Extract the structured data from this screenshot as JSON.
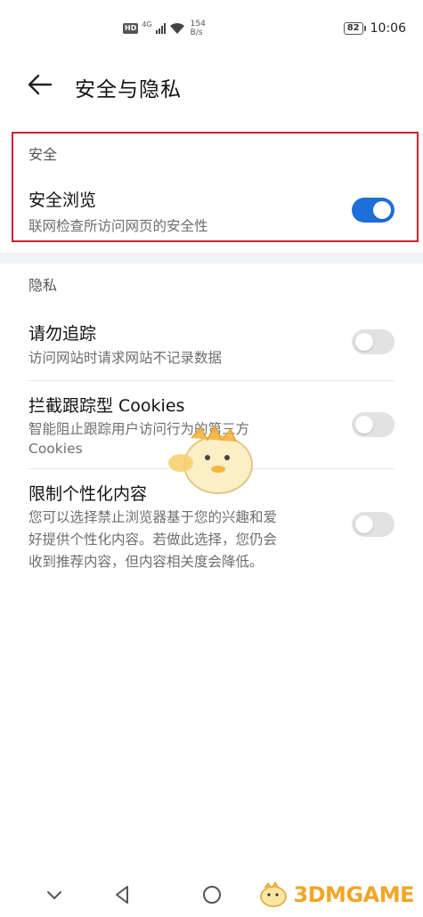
{
  "status_bar": {
    "hd": "HD",
    "network": "4G",
    "speed_value": "154",
    "speed_unit": "B/s",
    "battery": "82",
    "time": "10:06"
  },
  "header": {
    "title": "安全与隐私"
  },
  "security": {
    "header": "安全",
    "safe_browsing": {
      "title": "安全浏览",
      "subtitle": "联网检查所访问网页的安全性",
      "enabled": true
    }
  },
  "privacy": {
    "header": "隐私",
    "do_not_track": {
      "title": "请勿追踪",
      "subtitle": "访问网站时请求网站不记录数据",
      "enabled": false
    },
    "block_cookies": {
      "title": "拦截跟踪型 Cookies",
      "subtitle_line1": "智能阻止跟踪用户访问行为的第三方",
      "subtitle_line2": "Cookies",
      "enabled": false
    },
    "limit_personalization": {
      "title": "限制个性化内容",
      "subtitle_line1": "您可以选择禁止浏览器基于您的兴趣和爱",
      "subtitle_line2": "好提供个性化内容。若做此选择，您仍会",
      "subtitle_line3": "收到推荐内容，但内容相关度会降低。",
      "enabled": false
    }
  },
  "watermark": {
    "text": "3DMGAME"
  },
  "colors": {
    "accent": "#1e6fd9",
    "highlight_box": "#d0212f",
    "toggle_off": "#e2e2e2",
    "watermark": "#f0a626"
  }
}
